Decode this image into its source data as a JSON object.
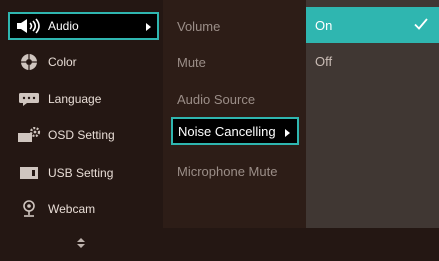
{
  "main_menu": {
    "items": [
      {
        "label": "Audio",
        "icon": "speaker-icon",
        "selected": true
      },
      {
        "label": "Color",
        "icon": "color-wheel-icon",
        "selected": false
      },
      {
        "label": "Language",
        "icon": "language-icon",
        "selected": false
      },
      {
        "label": "OSD Setting",
        "icon": "osd-setting-icon",
        "selected": false
      },
      {
        "label": "USB Setting",
        "icon": "usb-icon",
        "selected": false
      },
      {
        "label": "Webcam",
        "icon": "webcam-icon",
        "selected": false
      }
    ],
    "scroll_icon": "up-down-arrows-icon"
  },
  "submenu": {
    "items": [
      {
        "label": "Volume",
        "selected": false
      },
      {
        "label": "Mute",
        "selected": false
      },
      {
        "label": "Audio Source",
        "selected": false
      },
      {
        "label": "Noise Cancelling",
        "selected": true
      },
      {
        "label": "Microphone Mute",
        "selected": false
      }
    ]
  },
  "options": {
    "items": [
      {
        "label": "On",
        "active": true,
        "checked": true
      },
      {
        "label": "Off",
        "active": false,
        "checked": false
      }
    ]
  },
  "colors": {
    "accent": "#2fb6b0",
    "background": "#241713",
    "panel": "#403733",
    "text": "#e8ddd6"
  }
}
